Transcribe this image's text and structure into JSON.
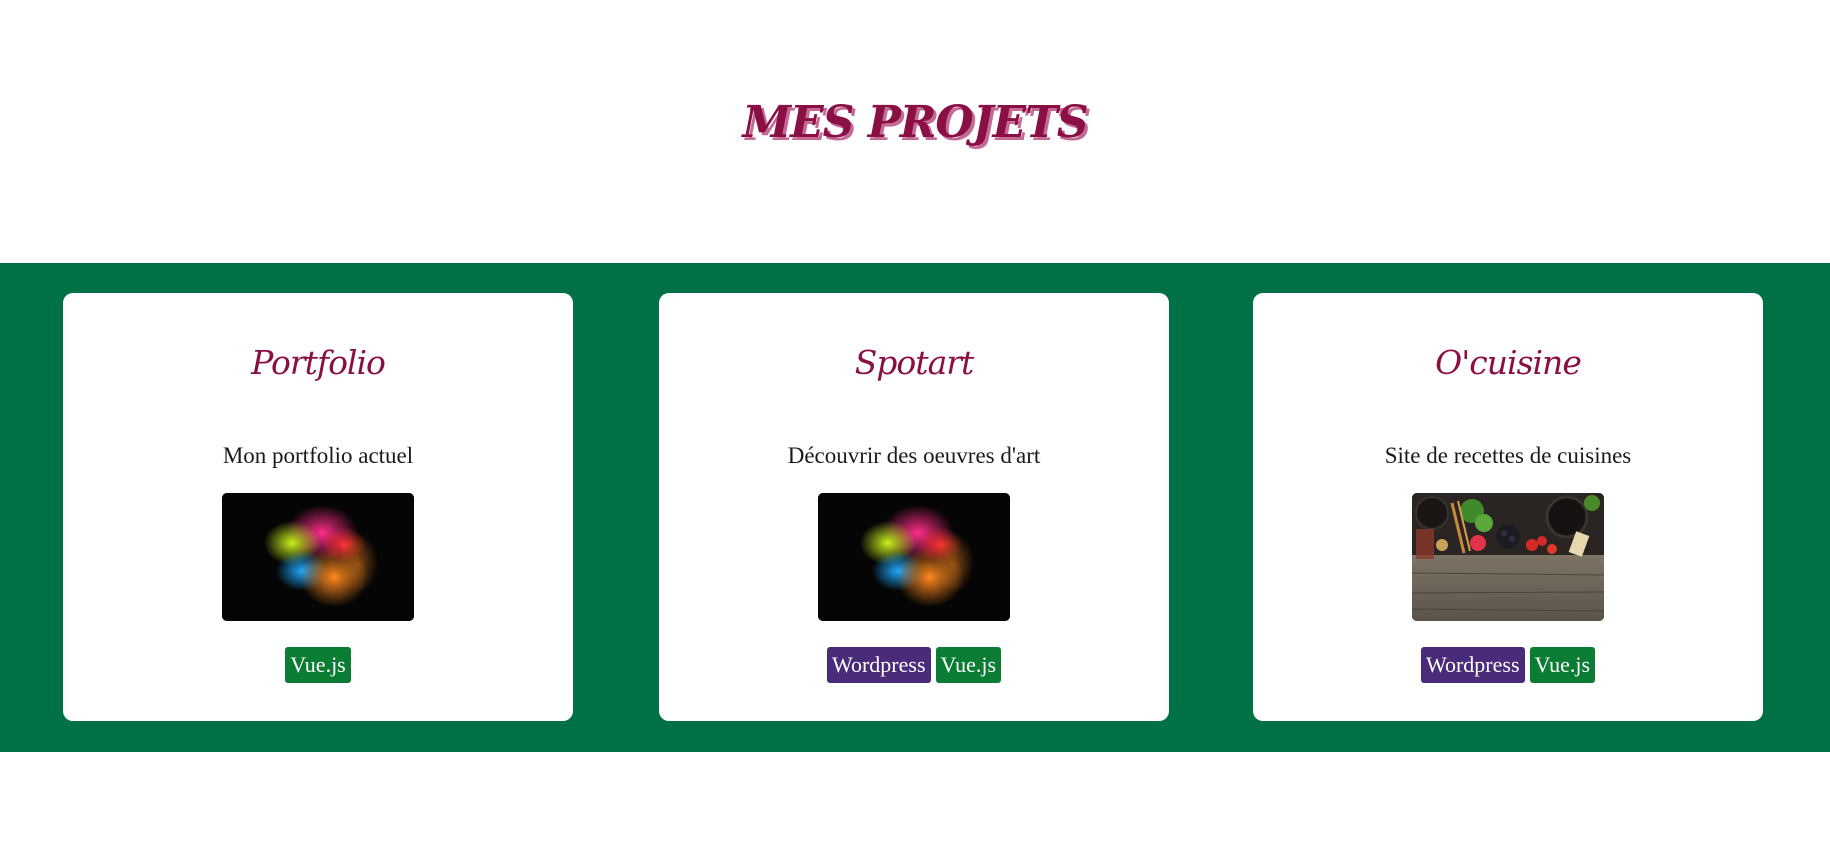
{
  "page": {
    "title": "MES PROJETS"
  },
  "colors": {
    "accent": "#8a0f45",
    "band": "#007046",
    "wordpress_tag": "#4a2b7a",
    "vue_tag": "#0a7c33"
  },
  "projects": [
    {
      "title": "Portfolio",
      "description": "Mon portfolio actuel",
      "image": "colorful-powder-explosion",
      "tags": [
        "Vue.js"
      ]
    },
    {
      "title": "Spotart",
      "description": "Découvrir des oeuvres d'art",
      "image": "colorful-powder-explosion",
      "tags": [
        "Wordpress",
        "Vue.js"
      ]
    },
    {
      "title": "O'cuisine",
      "description": "Site de recettes de cuisines",
      "image": "cooking-ingredients-on-wood",
      "tags": [
        "Wordpress",
        "Vue.js"
      ]
    }
  ]
}
